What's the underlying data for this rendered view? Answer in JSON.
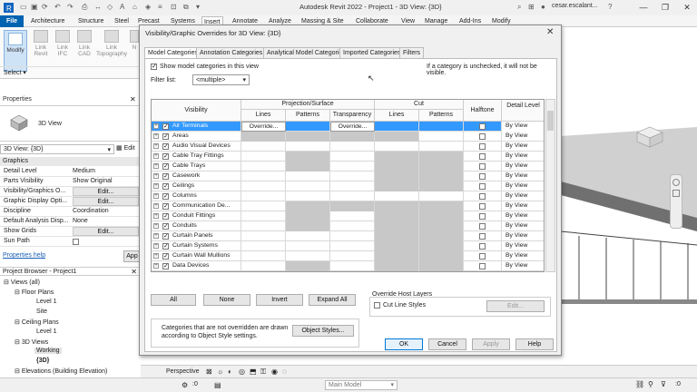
{
  "titlebar": {
    "title": "Autodesk Revit 2022 - Project1 - 3D View: {3D}",
    "user": "cesar.escalant...",
    "minimize": "—",
    "maximize": "❐",
    "close": "✕"
  },
  "ribbon_tabs": [
    "File",
    "Architecture",
    "Structure",
    "Steel",
    "Precast",
    "Systems",
    "Insert",
    "Annotate",
    "Analyze",
    "Massing & Site",
    "Collaborate",
    "View",
    "Manage",
    "Add-Ins",
    "Modify"
  ],
  "ribbon": {
    "buttons": [
      {
        "label": "Modify"
      },
      {
        "label": "Link Revit"
      },
      {
        "label": "Link IFC"
      },
      {
        "label": "Link CAD"
      },
      {
        "label": "Link Topography"
      },
      {
        "label": "N"
      }
    ],
    "select_label": "Select ▾"
  },
  "properties": {
    "title": "Properties",
    "type_label": "3D View",
    "view_selector": "3D View: {3D}",
    "edit_type": "Edit",
    "section": "Graphics",
    "rows": [
      {
        "key": "Detail Level",
        "value": "Medium"
      },
      {
        "key": "Parts Visibility",
        "value": "Show Original"
      },
      {
        "key": "Visibility/Graphics O...",
        "value": "Edit..."
      },
      {
        "key": "Graphic Display Opti...",
        "value": "Edit..."
      },
      {
        "key": "Discipline",
        "value": "Coordination"
      },
      {
        "key": "Default Analysis Disp...",
        "value": "None"
      },
      {
        "key": "Show Grids",
        "value": "Edit..."
      },
      {
        "key": "Sun Path",
        "value": ""
      }
    ],
    "help_link": "Properties help",
    "apply": "App"
  },
  "browser": {
    "title": "Project Browser - Project1",
    "items": [
      {
        "label": "Views (all)",
        "level": 0
      },
      {
        "label": "Floor Plans",
        "level": 1
      },
      {
        "label": "Level 1",
        "level": 2
      },
      {
        "label": "Site",
        "level": 2
      },
      {
        "label": "Ceiling Plans",
        "level": 1
      },
      {
        "label": "Level 1",
        "level": 2
      },
      {
        "label": "3D Views",
        "level": 1
      },
      {
        "label": "Working",
        "level": 2
      },
      {
        "label": "{3D}",
        "level": 2
      },
      {
        "label": "Elevations (Building Elevation)",
        "level": 1
      }
    ]
  },
  "dialog": {
    "title": "Visibility/Graphic Overrides for 3D View: {3D}",
    "close": "✕",
    "tabs": [
      "Model Categories",
      "Annotation Categories",
      "Analytical Model Categories",
      "Imported Categories",
      "Filters"
    ],
    "show_categories_label": "Show model categories in this view",
    "note": "If a category is unchecked, it will not be visible.",
    "filter_label": "Filter list:",
    "filter_value": "<multiple>",
    "headers": {
      "visibility": "Visibility",
      "projection_surface": "Projection/Surface",
      "cut": "Cut",
      "halftone": "Halftone",
      "detail_level": "Detail Level",
      "lines": "Lines",
      "patterns": "Patterns",
      "transparency": "Transparency",
      "cut_lines": "Lines",
      "cut_patterns": "Patterns"
    },
    "rows": [
      {
        "name": "Air Terminals",
        "proj_lines": "Override...",
        "proj_trans": "Override...",
        "detail": "By View",
        "selected": true
      },
      {
        "name": "Areas",
        "detail": "By View"
      },
      {
        "name": "Audio Visual Devices",
        "detail": "By View"
      },
      {
        "name": "Cable Tray Fittings",
        "detail": "By View"
      },
      {
        "name": "Cable Trays",
        "detail": "By View"
      },
      {
        "name": "Casework",
        "detail": "By View"
      },
      {
        "name": "Ceilings",
        "detail": "By View"
      },
      {
        "name": "Columns",
        "detail": "By View"
      },
      {
        "name": "Communication De...",
        "detail": "By View"
      },
      {
        "name": "Conduit Fittings",
        "detail": "By View"
      },
      {
        "name": "Conduits",
        "detail": "By View"
      },
      {
        "name": "Curtain Panels",
        "detail": "By View"
      },
      {
        "name": "Curtain Systems",
        "detail": "By View"
      },
      {
        "name": "Curtain Wall Mullions",
        "detail": "By View"
      },
      {
        "name": "Data Devices",
        "detail": "By View"
      }
    ],
    "buttons": {
      "all": "All",
      "none": "None",
      "invert": "Invert",
      "expand_all": "Expand All",
      "override_group": "Override Host Layers",
      "cut_line_styles": "Cut Line Styles",
      "edit": "Edit...",
      "info": "Categories that are not overridden are drawn according to Object Style settings.",
      "object_styles": "Object Styles...",
      "ok": "OK",
      "cancel": "Cancel",
      "apply": "Apply",
      "help": "Help"
    }
  },
  "viewbar": {
    "perspective": "Perspective"
  },
  "status": {
    "model": "Main Model",
    "zero": ":0"
  }
}
